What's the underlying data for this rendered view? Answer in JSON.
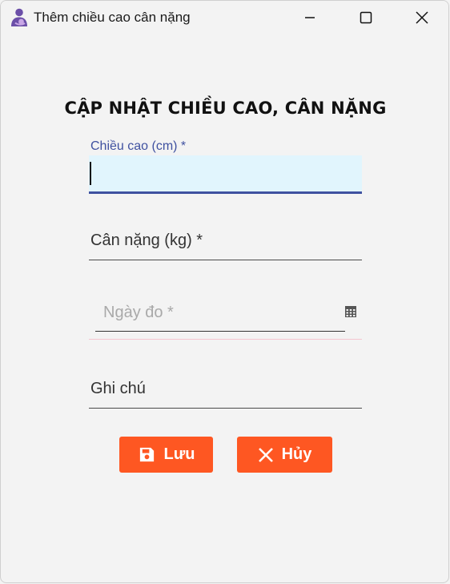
{
  "window": {
    "title": "Thêm chiều cao cân nặng",
    "controls": [
      "minimize",
      "maximize",
      "close"
    ]
  },
  "form": {
    "title": "CẬP NHẬT CHIỀU CAO, CÂN NẶNG",
    "height": {
      "label": "Chiều cao (cm) *",
      "value": ""
    },
    "weight": {
      "label": "Cân nặng (kg) *",
      "value": ""
    },
    "date": {
      "placeholder": "Ngày đo *",
      "icon": "calendar-icon"
    },
    "note": {
      "label": "Ghi chú",
      "value": ""
    }
  },
  "buttons": {
    "save_label": "Lưu",
    "cancel_label": "Hủy",
    "color": "#fe5722"
  },
  "colors": {
    "accent": "#3f51a0",
    "focus_bg": "#e1f5fd",
    "button": "#fe5722"
  }
}
